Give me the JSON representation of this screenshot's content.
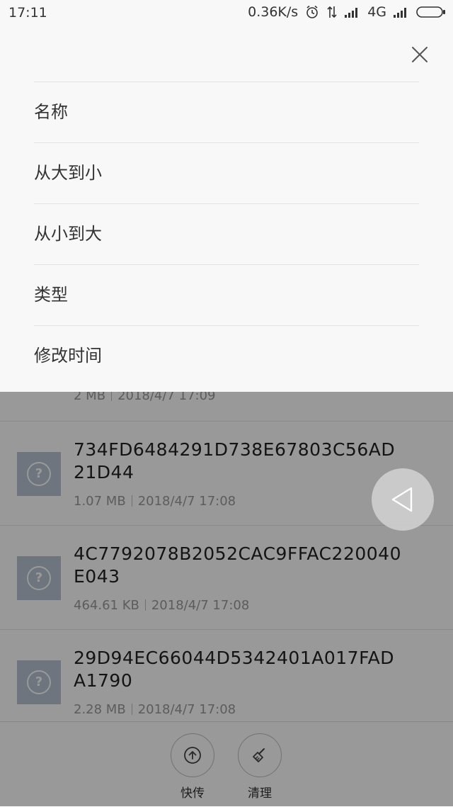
{
  "status_bar": {
    "time": "17:11",
    "speed": "0.36K/s",
    "network": "4G"
  },
  "sort_menu": {
    "options": [
      "名称",
      "从大到小",
      "从小到大",
      "类型",
      "修改时间"
    ]
  },
  "files": {
    "partial_row": {
      "size": "2 MB",
      "date": "2018/4/7 17:09"
    },
    "rows": [
      {
        "name": "734FD6484291D738E67803C56AD21D44",
        "size": "1.07 MB",
        "date": "2018/4/7 17:08"
      },
      {
        "name": "4C7792078B2052CAC9FFAC220040E043",
        "size": "464.61 KB",
        "date": "2018/4/7 17:08"
      },
      {
        "name": "29D94EC66044D5342401A017FADA1790",
        "size": "2.28 MB",
        "date": "2018/4/7 17:08"
      }
    ]
  },
  "bottom_bar": {
    "quick_transfer_label": "快传",
    "clean_label": "清理"
  }
}
